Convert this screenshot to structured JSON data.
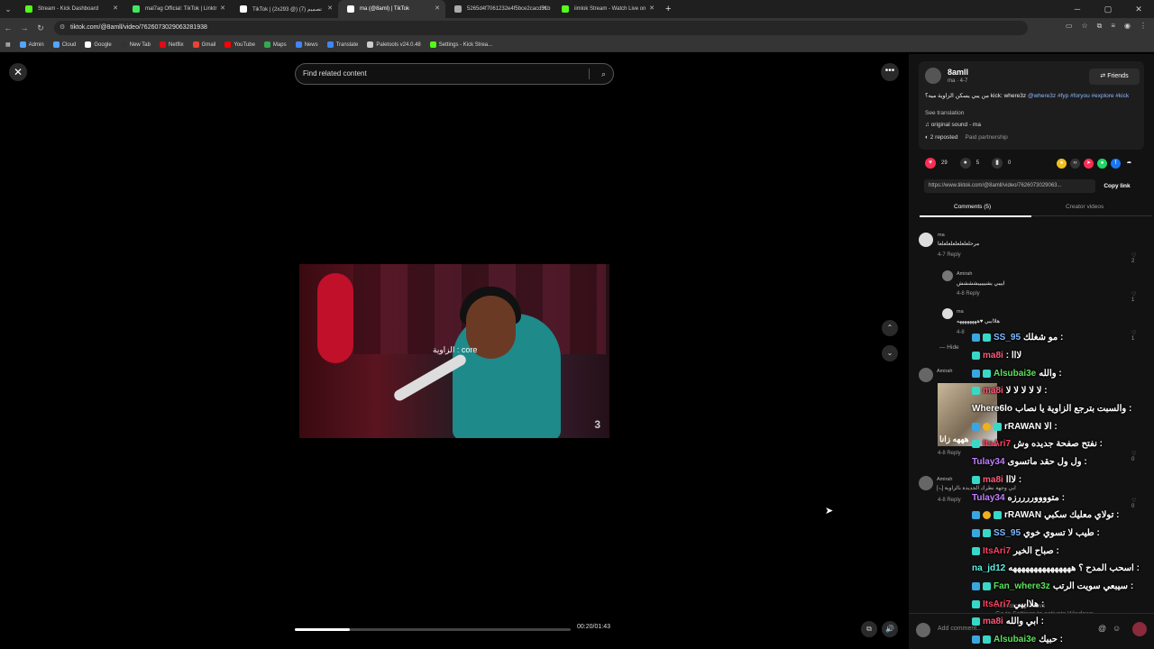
{
  "browser": {
    "tabs": [
      {
        "title": "Stream - Kick Dashboard",
        "color": "#53fc18",
        "active": false
      },
      {
        "title": "mal7ag Official: TikTok | Linktr",
        "color": "#43e660",
        "active": false
      },
      {
        "title": "TikTok | (2x293 @) تصميم (7)",
        "color": "#ffffff",
        "active": false
      },
      {
        "title": "ma (@8aml) | TikTok",
        "color": "#ffffff",
        "active": true
      },
      {
        "title": "5265d4f7061232e4f5bce2cacd51b",
        "color": "#aaaaaa",
        "active": false
      },
      {
        "title": "iimlok Stream - Watch Live on",
        "color": "#53fc18",
        "active": false
      }
    ],
    "url": "tiktok.com/@8amll/video/7626073029063281938",
    "bookmarks": [
      {
        "label": "Admin",
        "color": "#53a6ff"
      },
      {
        "label": "Cloud",
        "color": "#53a6ff"
      },
      {
        "label": "Google",
        "color": "#ffffff"
      },
      {
        "label": "New Tab",
        "color": "#333333"
      },
      {
        "label": "Netflix",
        "color": "#e50914"
      },
      {
        "label": "Gmail",
        "color": "#ea4335"
      },
      {
        "label": "YouTube",
        "color": "#ff0000"
      },
      {
        "label": "Maps",
        "color": "#34a853"
      },
      {
        "label": "News",
        "color": "#4285f4"
      },
      {
        "label": "Translate",
        "color": "#4285f4"
      },
      {
        "label": "Paletools v24.0.48",
        "color": "#cccccc"
      },
      {
        "label": "Settings - Kick Strea...",
        "color": "#53fc18"
      }
    ]
  },
  "video": {
    "search_placeholder": "Find related content",
    "timecode": "00:20/01:43",
    "progress": 0.2,
    "caption": "الزاوية : core"
  },
  "post": {
    "username": "8amll",
    "subline": "ma · 4-7",
    "friends_label": "Friends",
    "description_text": "من يبي يسكن الزاوية ميه؟ kick: where3z",
    "description_tags": "@where3z #fyp #foryou #explore #kick",
    "see_translation": "See translation",
    "sound": "original sound - ma",
    "reposted": "2 reposted",
    "paid": "Paid partnership",
    "likes": "29",
    "comments_count": "5",
    "saves": "0",
    "link": "https://www.tiktok.com/@8amll/video/7626073029063...",
    "copy_label": "Copy link",
    "tab_comments": "Comments (5)",
    "tab_creator": "Creator videos"
  },
  "comments": [
    {
      "name": "ma",
      "text": "مرحلعلعلعلعلعلعلعا",
      "meta": "4-7   Reply",
      "likes": "♡ 2"
    },
    {
      "name": "Amirah",
      "text": "اييبي يشيييييشششش",
      "meta": "4-8   Reply",
      "likes": "♡ 1"
    },
    {
      "name": "ma",
      "text": "هلاابيي ♥ههههههههه",
      "meta": "4-8",
      "likes": "♡ 1"
    },
    {
      "name": "Hide",
      "text": "",
      "meta": "",
      "likes": ""
    },
    {
      "name": "Amirah",
      "text": "",
      "meta": "4-8   Reply",
      "likes": "♡ 0"
    },
    {
      "name": "Amirah",
      "text": "[-ـ] ابي وجهة نظرك الجديدة بالزاوية",
      "meta": "4-8   Reply",
      "likes": "♡ 0"
    }
  ],
  "image_overlay": "هههه زانا",
  "chat": [
    {
      "user": "SS_95",
      "color": "#7fb8ff",
      "msg": "مو شغلك :",
      "badges": [
        "blue",
        "teal"
      ]
    },
    {
      "user": "ma8i",
      "color": "#ff5a7a",
      "msg": ": لااا",
      "badges": [
        "teal"
      ]
    },
    {
      "user": "Alsubai3e",
      "color": "#5de05d",
      "msg": "والله :",
      "badges": [
        "blue",
        "teal"
      ]
    },
    {
      "user": "ma8i",
      "color": "#ff5a7a",
      "msg": "لا لا لا لا لا :",
      "badges": [
        "teal"
      ]
    },
    {
      "user": "Where6lo",
      "color": "#ffffff",
      "msg": "والسبت بترجع الزاوية يا نصاب :",
      "badges": []
    },
    {
      "user": "rRAWAN",
      "color": "#ffffff",
      "msg": "الا :",
      "badges": [
        "blue",
        "gold",
        "teal"
      ]
    },
    {
      "user": "ItsAri7",
      "color": "#ff4060",
      "msg": "نفتح صفحة جديده وش :",
      "badges": [
        "teal"
      ]
    },
    {
      "user": "Tulay34",
      "color": "#c080ff",
      "msg": "ول ول حقد ماتسوى :",
      "badges": []
    },
    {
      "user": "ma8i",
      "color": "#ff5a7a",
      "msg": "لااا :",
      "badges": [
        "teal"
      ]
    },
    {
      "user": "Tulay34",
      "color": "#c080ff",
      "msg": "متووووررررزه :",
      "badges": []
    },
    {
      "user": "rRAWAN",
      "color": "#ffffff",
      "msg": "تولاي معليك سكبي :",
      "badges": [
        "blue",
        "gold",
        "teal"
      ]
    },
    {
      "user": "SS_95",
      "color": "#7fb8ff",
      "msg": "طيب لا تسوي خوي :",
      "badges": [
        "blue",
        "teal"
      ]
    },
    {
      "user": "ItsAri7",
      "color": "#ff4060",
      "msg": "صباح الخير :",
      "badges": [
        "teal"
      ]
    },
    {
      "user": "na_jd12",
      "color": "#5df0e0",
      "msg": "اسحب المدح ؟ هههههههههههههههه :",
      "badges": []
    },
    {
      "user": "Fan_where3z",
      "color": "#5de05d",
      "msg": "سيبعي سويت الرتب :",
      "badges": [
        "blue",
        "teal"
      ]
    },
    {
      "user": "ItsAri7",
      "color": "#ff4060",
      "msg": "هلاابيي :",
      "badges": [
        "teal"
      ]
    },
    {
      "user": "ma8i",
      "color": "#ff5a7a",
      "msg": "ابي والله :",
      "badges": [
        "teal"
      ]
    },
    {
      "user": "Alsubai3e",
      "color": "#5de05d",
      "msg": "حبيك :",
      "badges": [
        "blue",
        "teal"
      ]
    }
  ],
  "add_comment_placeholder": "Add comment...",
  "windows_watermark": "Activate Windows\nGo to Settings to activate Windows."
}
